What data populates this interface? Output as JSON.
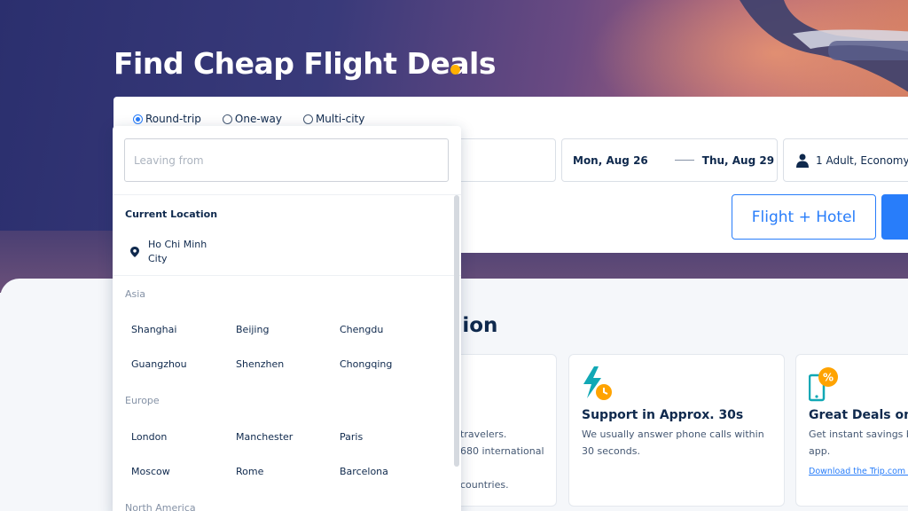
{
  "hero": {
    "title": "Find Cheap Flight Deals"
  },
  "trip_types": [
    {
      "label": "Round-trip",
      "selected": true
    },
    {
      "label": "One-way",
      "selected": false
    },
    {
      "label": "Multi-city",
      "selected": false
    }
  ],
  "search": {
    "leaving_placeholder": "Leaving from",
    "depart_date": "Mon, Aug 26",
    "return_date": "Thu, Aug 29",
    "passengers": "1 Adult, Economy",
    "flight_hotel_label": "Flight + Hotel"
  },
  "dropdown": {
    "current_location_heading": "Current Location",
    "current_location": "Ho Chi Minh City",
    "regions": [
      {
        "name": "Asia",
        "cities": [
          "Shanghai",
          "Beijing",
          "Chengdu",
          "Guangzhou",
          "Shenzhen",
          "Chongqing"
        ]
      },
      {
        "name": "Europe",
        "cities": [
          "London",
          "Manchester",
          "Paris",
          "Moscow",
          "Rome",
          "Barcelona"
        ]
      },
      {
        "name": "North America",
        "cities": []
      }
    ]
  },
  "section": {
    "title_partial": "nion"
  },
  "cards": [
    {
      "text_lines": [
        "travelers.",
        "680 international",
        "",
        "countries."
      ]
    },
    {
      "title": "Support in Approx. 30s",
      "text": "We usually answer phone calls within 30 seconds."
    },
    {
      "title": "Great Deals on t",
      "text": "Get instant savings b app.",
      "link": "Download the Trip.com A"
    }
  ],
  "colors": {
    "accent": "#287dfa",
    "title_dot": "#ffb000",
    "text_dark": "#0f294d"
  }
}
